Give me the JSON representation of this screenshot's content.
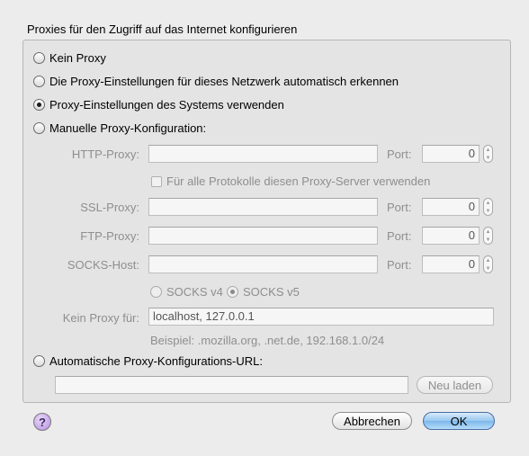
{
  "section_title": "Proxies für den Zugriff auf das Internet konfigurieren",
  "radios": {
    "no_proxy": "Kein Proxy",
    "auto_detect": "Die Proxy-Einstellungen für dieses Netzwerk automatisch erkennen",
    "system": "Proxy-Einstellungen des Systems verwenden",
    "manual": "Manuelle Proxy-Konfiguration:",
    "auto_url": "Automatische Proxy-Konfigurations-URL:"
  },
  "selected_radio": "system",
  "manual": {
    "http_label": "HTTP-Proxy:",
    "ssl_label": "SSL-Proxy:",
    "ftp_label": "FTP-Proxy:",
    "socks_label": "SOCKS-Host:",
    "port_label": "Port:",
    "http_host": "",
    "http_port": "0",
    "ssl_host": "",
    "ssl_port": "0",
    "ftp_host": "",
    "ftp_port": "0",
    "socks_host": "",
    "socks_port": "0",
    "same_proxy_checkbox": "Für alle Protokolle diesen Proxy-Server verwenden",
    "socks_v4": "SOCKS v4",
    "socks_v5": "SOCKS v5",
    "no_proxy_label": "Kein Proxy für:",
    "no_proxy_value": "localhost, 127.0.0.1",
    "example": "Beispiel: .mozilla.org, .net.de, 192.168.1.0/24"
  },
  "auto_url": {
    "value": "",
    "reload_button": "Neu laden"
  },
  "footer": {
    "help": "?",
    "cancel": "Abbrechen",
    "ok": "OK"
  }
}
